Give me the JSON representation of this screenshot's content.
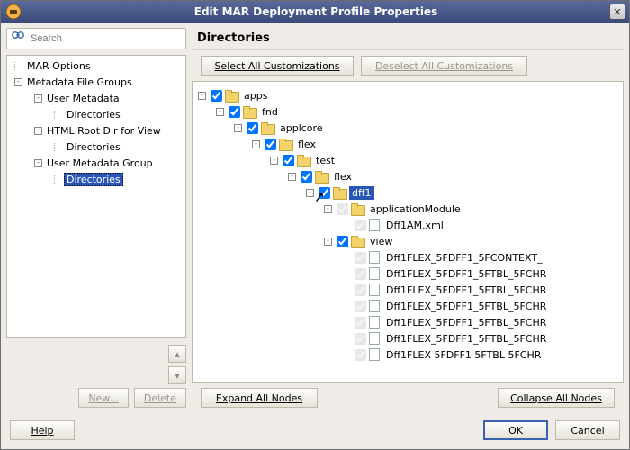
{
  "window": {
    "title": "Edit MAR Deployment Profile Properties"
  },
  "search": {
    "placeholder": "Search"
  },
  "nav": {
    "items": [
      {
        "label": "MAR Options",
        "depth": 0,
        "kind": "node",
        "collapser": null
      },
      {
        "label": "Metadata File Groups",
        "depth": 0,
        "kind": "node",
        "collapser": "-"
      },
      {
        "label": "User Metadata",
        "depth": 1,
        "kind": "node",
        "collapser": "-"
      },
      {
        "label": "Directories",
        "depth": 2,
        "kind": "leaf",
        "collapser": null
      },
      {
        "label": "HTML Root Dir for View",
        "depth": 1,
        "kind": "node",
        "collapser": "-"
      },
      {
        "label": "Directories",
        "depth": 2,
        "kind": "leaf",
        "collapser": null
      },
      {
        "label": "User Metadata Group",
        "depth": 1,
        "kind": "node",
        "collapser": "-"
      },
      {
        "label": "Directories",
        "depth": 2,
        "kind": "leaf",
        "collapser": null,
        "selected": true
      }
    ]
  },
  "leftButtons": {
    "new": "New...",
    "delete": "Delete"
  },
  "arrows": {
    "up": "▴",
    "down": "▾"
  },
  "rightPanel": {
    "title": "Directories"
  },
  "toolbar": {
    "selectAll": "Select All Customizations",
    "deselectAll": "Deselect All Customizations"
  },
  "tree": {
    "rows": [
      {
        "depth": 0,
        "collapser": "-",
        "check": "on",
        "icon": "folder",
        "label": "apps"
      },
      {
        "depth": 1,
        "collapser": "-",
        "check": "on",
        "icon": "folder",
        "label": "fnd"
      },
      {
        "depth": 2,
        "collapser": "-",
        "check": "on",
        "icon": "folder",
        "label": "applcore"
      },
      {
        "depth": 3,
        "collapser": "-",
        "check": "on",
        "icon": "folder",
        "label": "flex"
      },
      {
        "depth": 4,
        "collapser": "-",
        "check": "on",
        "icon": "folder",
        "label": "test"
      },
      {
        "depth": 5,
        "collapser": "-",
        "check": "on",
        "icon": "folder",
        "label": "flex"
      },
      {
        "depth": 6,
        "collapser": "-",
        "check": "on",
        "icon": "folder",
        "label": "dff1",
        "selected": true,
        "cursor": true
      },
      {
        "depth": 7,
        "collapser": "-",
        "check": "dis",
        "icon": "folder",
        "label": "applicationModule"
      },
      {
        "depth": 8,
        "collapser": null,
        "check": "dis",
        "icon": "file",
        "label": "Dff1AM.xml"
      },
      {
        "depth": 7,
        "collapser": "-",
        "check": "on",
        "icon": "folder",
        "label": "view"
      },
      {
        "depth": 8,
        "collapser": null,
        "check": "dis",
        "icon": "file",
        "label": "Dff1FLEX_5FDFF1_5FCONTEXT_"
      },
      {
        "depth": 8,
        "collapser": null,
        "check": "dis",
        "icon": "file",
        "label": "Dff1FLEX_5FDFF1_5FTBL_5FCHR"
      },
      {
        "depth": 8,
        "collapser": null,
        "check": "dis",
        "icon": "file",
        "label": "Dff1FLEX_5FDFF1_5FTBL_5FCHR"
      },
      {
        "depth": 8,
        "collapser": null,
        "check": "dis",
        "icon": "file",
        "label": "Dff1FLEX_5FDFF1_5FTBL_5FCHR"
      },
      {
        "depth": 8,
        "collapser": null,
        "check": "dis",
        "icon": "file",
        "label": "Dff1FLEX_5FDFF1_5FTBL_5FCHR"
      },
      {
        "depth": 8,
        "collapser": null,
        "check": "dis",
        "icon": "file",
        "label": "Dff1FLEX_5FDFF1_5FTBL_5FCHR"
      },
      {
        "depth": 8,
        "collapser": null,
        "check": "dis",
        "icon": "file",
        "label": "Dff1FLEX 5FDFF1 5FTBL 5FCHR"
      }
    ]
  },
  "bottom": {
    "expand": "Expand All Nodes",
    "collapse": "Collapse All Nodes"
  },
  "dialog": {
    "help": "Help",
    "ok": "OK",
    "cancel": "Cancel"
  }
}
